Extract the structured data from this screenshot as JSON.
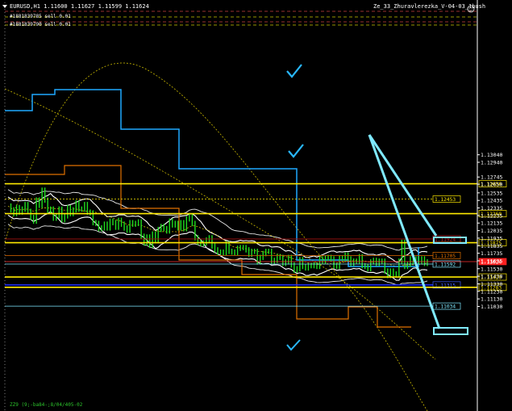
{
  "header": {
    "symbol_info": "EURUSD,H1  1.11600 1.11627 1.11599 1.11624",
    "indicator_name": "Ze_33_Zhuravlerezka_V-04-03_1bush"
  },
  "orders": [
    "#1881839785 sell 0.01",
    "#1881839790 sell 0.01"
  ],
  "footer_text": "ZZ9 (9;-ba84-;8/04/405-02",
  "colors": {
    "background": "#000000",
    "price": "#1fdc1f",
    "level_yellow": "#ffea00",
    "stepline_blue": "#1fa9ff",
    "arrow_cyan": "#7fe9ff",
    "bands": "#ffffff",
    "current_price_red": "#ff2020",
    "checkmark": "#29b8ff"
  },
  "icons": [
    "checkmark-icon",
    "smiley-icon",
    "triangle-down-icon"
  ],
  "chart_data": {
    "type": "line",
    "y_axis_ticks": [
      "1.13040",
      "1.12940",
      "1.12745",
      "1.12650",
      "1.12535",
      "1.12435",
      "1.12335",
      "1.12235",
      "1.12135",
      "1.12035",
      "1.11935",
      "1.11835",
      "1.11735",
      "1.11635",
      "1.11530",
      "1.11430",
      "1.11330",
      "1.11230",
      "1.11130",
      "1.11030"
    ],
    "ylim": [
      1.11,
      1.1306
    ],
    "levels": [
      {
        "label": "1.12656",
        "value": 1.12656,
        "style": "yellow"
      },
      {
        "label": "1.12453",
        "value": 1.12453,
        "style": "yellow-dash"
      },
      {
        "label": "1.12260",
        "value": 1.1226,
        "style": "yellow"
      },
      {
        "label": "1.11924",
        "value": 1.11924,
        "style": "darkred"
      },
      {
        "label": "1.11875",
        "value": 1.11875,
        "style": "yellow"
      },
      {
        "label": "1.11705",
        "value": 1.11705,
        "style": "orange"
      },
      {
        "label": "1.11624",
        "value": 1.11624,
        "style": "current"
      },
      {
        "label": "1.11592",
        "value": 1.11592,
        "style": "cyan"
      },
      {
        "label": "1.11420",
        "value": 1.1142,
        "style": "yellow"
      },
      {
        "label": "1.11315",
        "value": 1.11315,
        "style": "blue"
      },
      {
        "label": "1.11283",
        "value": 1.11283,
        "style": "yellow"
      },
      {
        "label": "1.11034",
        "value": 1.11034,
        "style": "cyan"
      }
    ],
    "current_price": 1.11624,
    "price_series": [
      1.1236,
      1.1231,
      1.1226,
      1.1234,
      1.1228,
      1.1232,
      1.1238,
      1.1229,
      1.1221,
      1.1216,
      1.1244,
      1.1237,
      1.1257,
      1.1244,
      1.123,
      1.1232,
      1.122,
      1.1223,
      1.1232,
      1.1218,
      1.1223,
      1.1234,
      1.1226,
      1.1231,
      1.124,
      1.1232,
      1.1232,
      1.1238,
      1.1228,
      1.1227,
      1.1214,
      1.1213,
      1.1206,
      1.1207,
      1.1212,
      1.1207,
      1.1216,
      1.1214,
      1.1208,
      1.1217,
      1.1212,
      1.1207,
      1.1204,
      1.1214,
      1.1212,
      1.1213,
      1.1215,
      1.1196,
      1.1187,
      1.1195,
      1.1184,
      1.1199,
      1.119,
      1.1205,
      1.1209,
      1.1206,
      1.1203,
      1.1216,
      1.1211,
      1.1213,
      1.1207,
      1.1214,
      1.1206,
      1.1219,
      1.1222,
      1.1213,
      1.1194,
      1.1188,
      1.1186,
      1.1187,
      1.1191,
      1.1194,
      1.1183,
      1.1178,
      1.1175,
      1.1175,
      1.1174,
      1.1186,
      1.1176,
      1.1175,
      1.1174,
      1.118,
      1.1181,
      1.1181,
      1.1178,
      1.1172,
      1.1176,
      1.1176,
      1.1162,
      1.1168,
      1.1173,
      1.1176,
      1.1176,
      1.1163,
      1.1164,
      1.1169,
      1.1168,
      1.116,
      1.1162,
      1.1168,
      1.1158,
      1.1151,
      1.1153,
      1.1165,
      1.1156,
      1.1154,
      1.1157,
      1.1157,
      1.1158,
      1.1156,
      1.1166,
      1.1163,
      1.1167,
      1.1168,
      1.1166,
      1.1157,
      1.1156,
      1.1167,
      1.1165,
      1.1171,
      1.1166,
      1.116,
      1.1163,
      1.1163,
      1.1169,
      1.1157,
      1.1156,
      1.1153,
      1.1162,
      1.1164,
      1.116,
      1.1163,
      1.1163,
      1.115,
      1.1144,
      1.115,
      1.1146,
      1.1145,
      1.1163,
      1.1188,
      1.1156,
      1.1159,
      1.1166,
      1.1162,
      1.1166,
      1.1163,
      1.1166,
      1.116,
      1.1162
    ]
  }
}
